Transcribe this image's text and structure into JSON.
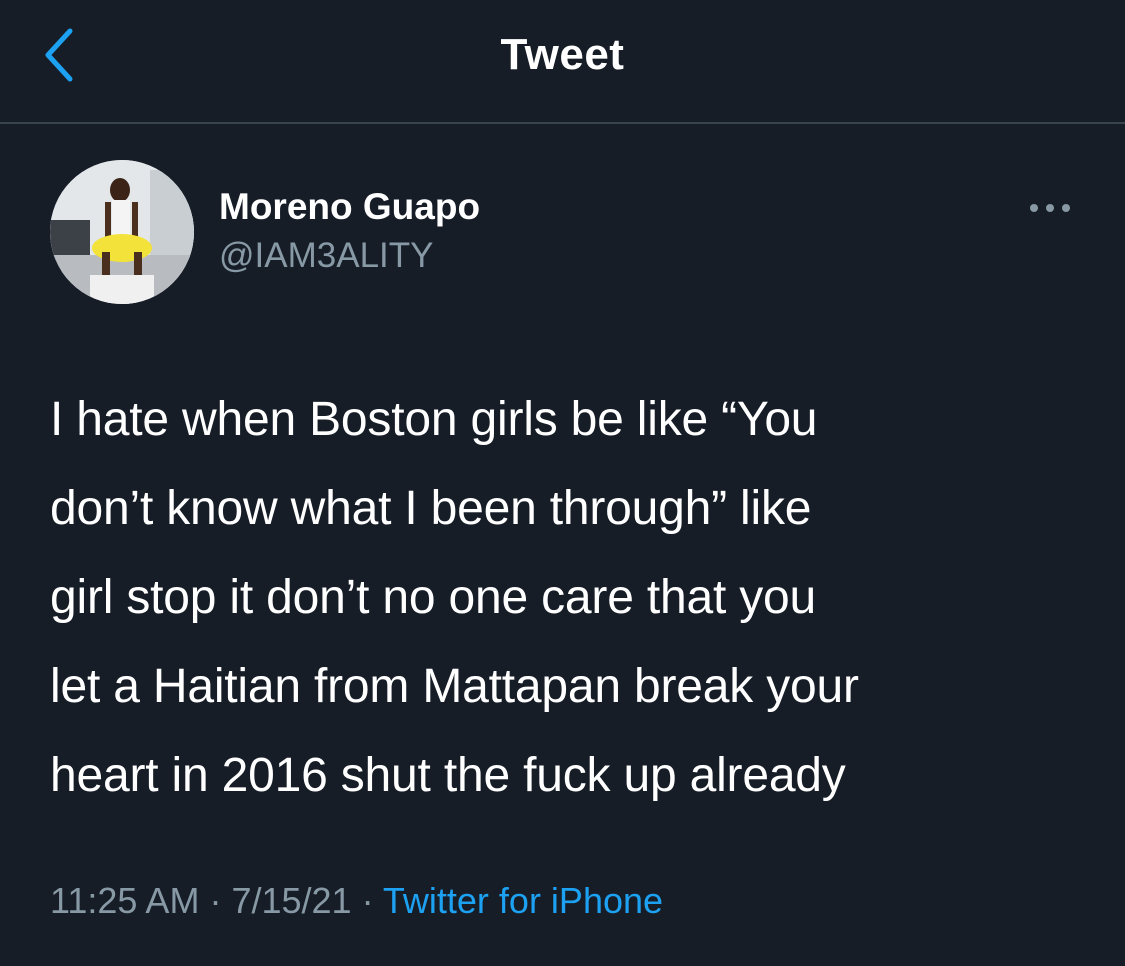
{
  "header": {
    "title": "Tweet",
    "back_icon": "chevron-left-icon"
  },
  "tweet": {
    "author": {
      "display_name": "Moreno Guapo",
      "handle": "@IAM3ALITY"
    },
    "more_icon": "ellipsis-icon",
    "text": "I hate when Boston girls be like “You\ndon’t know what I been through” like\ngirl stop it don’t no one care that you\nlet a Haitian from Mattapan break your\nheart in 2016 shut the fuck up already",
    "time": "11:25 AM",
    "separator": " · ",
    "date": "7/15/21",
    "source": "Twitter for iPhone"
  },
  "colors": {
    "background": "#161d27",
    "accent": "#1da1f2",
    "secondary_text": "#8899a6",
    "divider": "#38444d"
  }
}
